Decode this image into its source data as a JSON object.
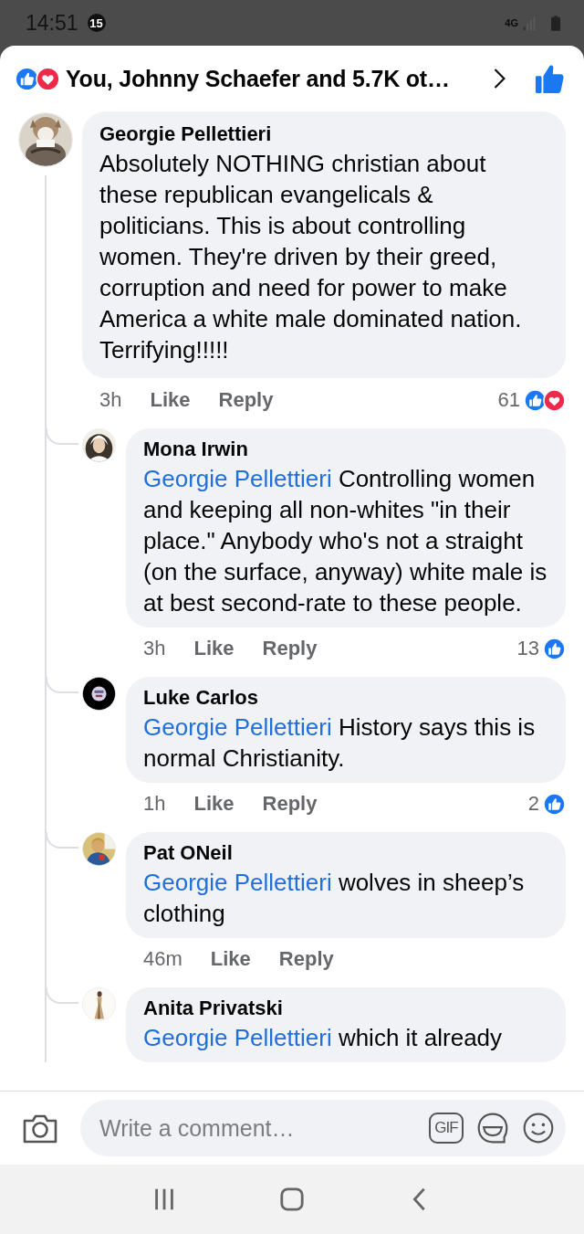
{
  "status_bar": {
    "time": "14:51",
    "notification_count": "15",
    "network_type": "4G"
  },
  "header": {
    "reactions": [
      {
        "kind": "like"
      },
      {
        "kind": "love"
      }
    ],
    "title": "You, Johnny Schaefer and 5.7K ot…"
  },
  "comment": {
    "author": "Georgie Pellettieri",
    "text": "Absolutely NOTHING christian about these republican evangelicals & politicians. This is about controlling women. They're driven by their greed, corruption and need for power to make America a white male dominated nation. Terrifying!!!!!",
    "time": "3h",
    "like": "Like",
    "reply": "Reply",
    "reaction_count": "61",
    "reactions": [
      {
        "kind": "like"
      },
      {
        "kind": "love"
      }
    ],
    "replies": [
      {
        "author": "Mona Irwin",
        "mention": "Georgie Pellettieri",
        "text": "Controlling women and keeping all non-whites \"in their place.\" Anybody who's not a straight (on the surface, anyway) white male is at best second-rate to these people.",
        "time": "3h",
        "like": "Like",
        "reply": "Reply",
        "reaction_count": "13",
        "reactions": [
          {
            "kind": "like"
          }
        ]
      },
      {
        "author": "Luke Carlos",
        "mention": "Georgie Pellettieri",
        "text": " History says this is normal Christianity.",
        "time": "1h",
        "like": "Like",
        "reply": "Reply",
        "reaction_count": "2",
        "reactions": [
          {
            "kind": "like"
          }
        ]
      },
      {
        "author": "Pat ONeil",
        "mention": "Georgie Pellettieri",
        "text": "wolves in sheep’s clothing",
        "time": "46m",
        "like": "Like",
        "reply": "Reply"
      },
      {
        "author": "Anita Privatski",
        "mention": "Georgie Pellettieri",
        "text": "which it already"
      }
    ]
  },
  "composer": {
    "placeholder": "Write a comment…",
    "gif_label": "GIF"
  }
}
